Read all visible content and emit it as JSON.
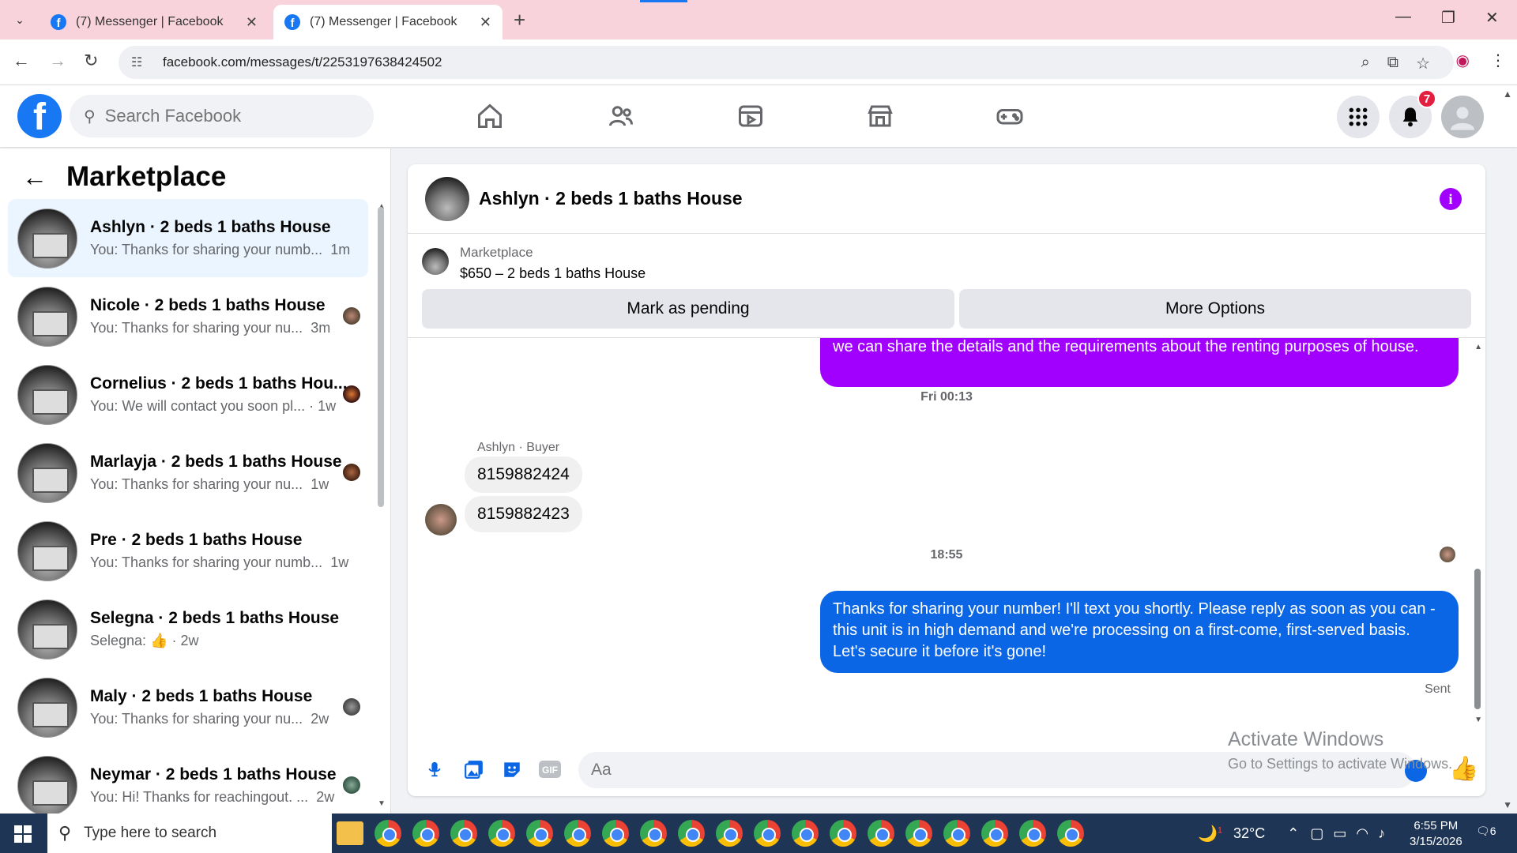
{
  "browser": {
    "tabs": [
      {
        "title": "(7) Messenger | Facebook"
      },
      {
        "title": "(7) Messenger | Facebook"
      }
    ],
    "url": "facebook.com/messages/t/2253197638424502"
  },
  "fb_header": {
    "search_placeholder": "Search Facebook",
    "notification_count": "7"
  },
  "sidebar": {
    "title": "Marketplace",
    "conversations": [
      {
        "name": "Ashlyn · 2 beds 1 baths House",
        "preview": "You: Thanks for sharing your numb...",
        "time": "1m",
        "active": true
      },
      {
        "name": "Nicole · 2 beds 1 baths House",
        "preview": "You: Thanks for sharing your nu...",
        "time": "3m"
      },
      {
        "name": "Cornelius · 2 beds 1 baths Hou...",
        "preview": "You: We will contact you soon pl...",
        "time": "1w"
      },
      {
        "name": "Marlayja · 2 beds 1 baths House",
        "preview": "You: Thanks for sharing your nu...",
        "time": "1w"
      },
      {
        "name": "Pre · 2 beds 1 baths House",
        "preview": "You: Thanks for sharing your numb...",
        "time": "1w"
      },
      {
        "name": "Selegna · 2 beds 1 baths House",
        "preview": "Selegna:",
        "time": "2w"
      },
      {
        "name": "Maly · 2 beds 1 baths House",
        "preview": "You: Thanks for sharing your nu...",
        "time": "2w"
      },
      {
        "name": "Neymar · 2 beds 1 baths House",
        "preview": "You: Hi! Thanks for reachingout. ...",
        "time": "2w"
      }
    ]
  },
  "chat": {
    "title": "Ashlyn · 2 beds 1 baths House",
    "listing": {
      "label": "Marketplace",
      "price_title": "$650 – 2 beds 1 baths House",
      "primary_button": "Mark as pending",
      "secondary_button": "More Options"
    },
    "messages": {
      "outgoing_partial": "we can share  the details and the requirements about the renting  purposes  of house.",
      "timestamp1": "Fri 00:13",
      "sender_label": "Ashlyn · Buyer",
      "incoming1": "8159882424",
      "incoming2": "8159882423",
      "timestamp2": "18:55",
      "outgoing_final": "Thanks for sharing your number! I'll text you shortly. Please reply as soon as you can - this unit is in high demand and we're processing on a first-come, first-served basis. Let's secure it before it's gone!",
      "status": "Sent"
    },
    "composer_placeholder": "Aa"
  },
  "watermark": {
    "line1": "Activate Windows",
    "line2": "Go to Settings to activate Windows."
  },
  "taskbar": {
    "search_placeholder": "Type here to search",
    "temperature": "32°C",
    "time": "6:55 PM",
    "date": "3/15/2026",
    "notifications": "6",
    "weather_badge": "1"
  },
  "colors": {
    "fb_blue": "#1877f2",
    "messenger_blue": "#0a66e4",
    "purple_bubble": "#a100ff",
    "tabbar_pink": "#f9d3dc"
  }
}
